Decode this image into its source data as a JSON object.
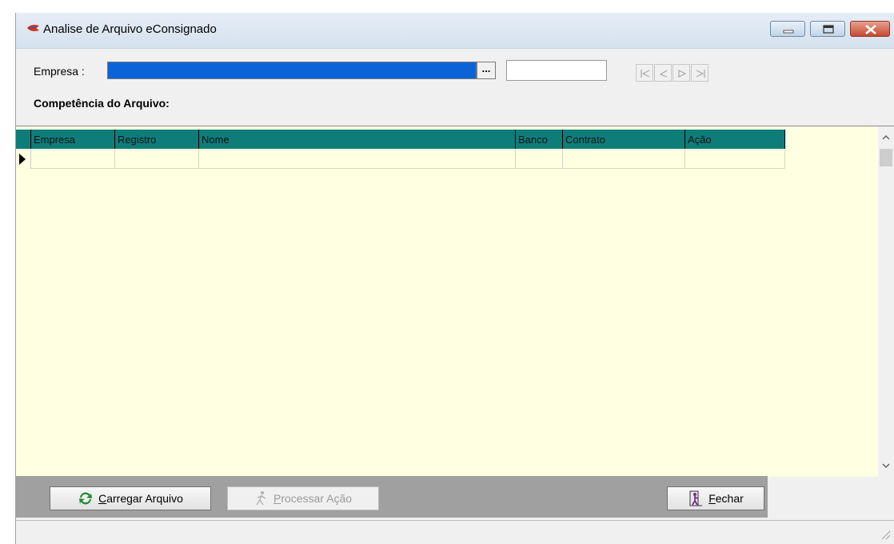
{
  "window": {
    "title": "Analise de Arquivo eConsignado",
    "controls": {
      "minimize": "minimize",
      "maximize": "maximize",
      "close": "close"
    }
  },
  "form": {
    "empresa_label": "Empresa :",
    "empresa_value": "",
    "lookup_button": "...",
    "empresa_code": "",
    "competencia_label": "Competência do Arquivo:"
  },
  "navigator": {
    "icons": [
      "first-icon",
      "prior-icon",
      "next-icon",
      "last-icon"
    ]
  },
  "grid": {
    "columns": [
      "Empresa",
      "Registro",
      "Nome",
      "Banco",
      "Contrato",
      "Ação"
    ],
    "rows": [
      [
        "",
        "",
        "",
        "",
        "",
        ""
      ]
    ],
    "colors": {
      "header_bg": "#0e7d7a",
      "grid_bg": "#ffffe1"
    }
  },
  "toolbar": {
    "carregar_prefix": "",
    "carregar_accel": "C",
    "carregar_rest": "arregar Arquivo",
    "processar_accel": "P",
    "processar_rest": "rocessar Ação",
    "fechar_accel": "F",
    "fechar_rest": "echar"
  }
}
